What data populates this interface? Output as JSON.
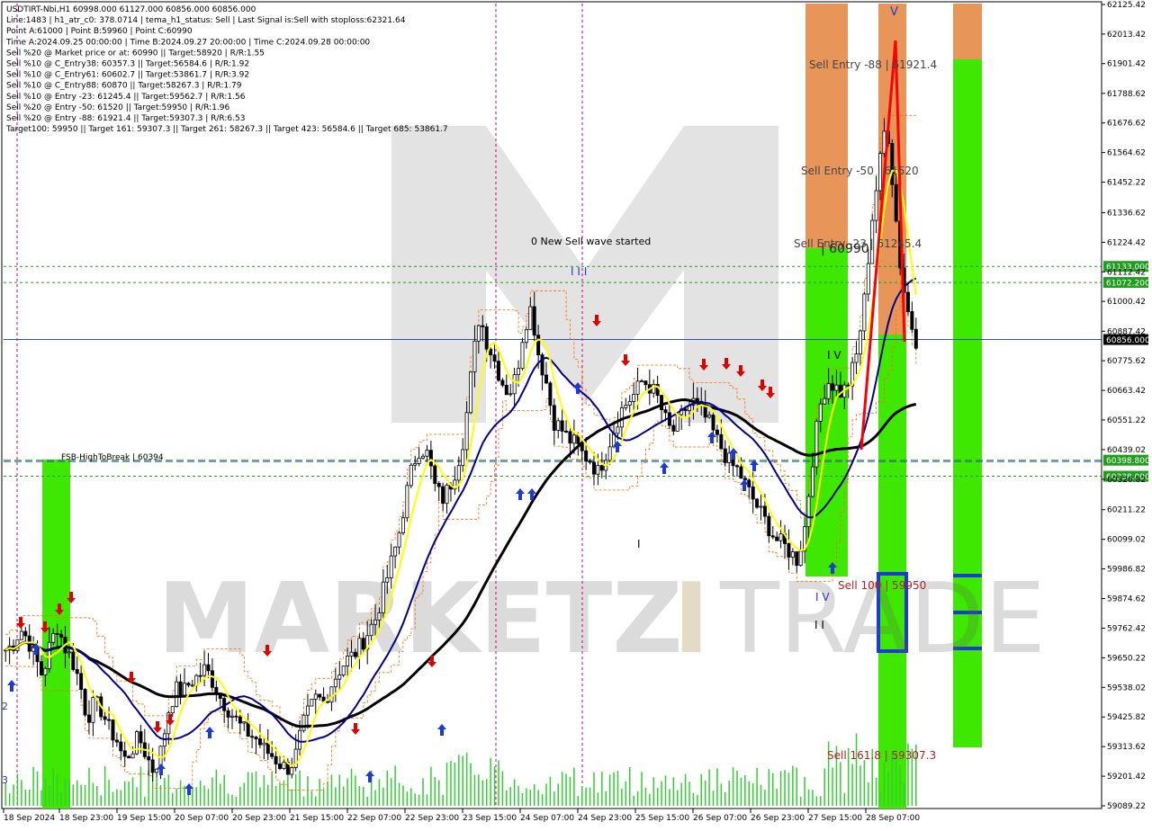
{
  "header": {
    "lines": [
      "USDTIRT-Nbi,H1  60998.000 61127.000 60856.000 60856.000",
      "Line:1483 | h1_atr_c0: 378.0714 | tema_h1_status: Sell | Last Signal is:Sell with stoploss:62321.64",
      "Point A:61000 | Point B:59960 | Point C:60990",
      "Time A:2024.09.25 00:00:00 | Time B:2024.09.27 20:00:00 | Time C:2024.09.28 00:00:00",
      "Sell %20 @ Market price or at: 60990 || Target:58920 | R/R:1.55",
      "Sell %10 @ C_Entry38: 60357.3 || Target:56584.6 | R/R:1.92",
      "Sell %10 @ C_Entry61: 60602.7 || Target:53861.7 | R/R:3.92",
      "Sell %10 @ C_Entry88: 60870 || Target:58267.3 | R/R:1.79",
      "Sell %10 @ Entry -23: 61245.4 || Target:59562.7 | R/R:1.56",
      "Sell %20 @ Entry -50: 61520 || Target:59950 | R/R:1.96",
      "Sell %20 @ Entry -88: 61921.4 || Target:59307.3 | R/R:6.53",
      "Target100: 59950 || Target 161: 59307.3 || Target 261: 58267.3 || Target 423: 56584.6 || Target 685: 53861.7"
    ]
  },
  "annotations": {
    "new_wave": "0 New Sell wave started",
    "fsb": "FSB-HighToBreak | 60394",
    "sell_entry_88": "Sell Entry -88 | 61921.4",
    "sell_entry_50": "Sell Entry -50 | 61520",
    "sell_entry_23": "Sell Entry -23 | 61245.4",
    "point_c_price": "| 60990",
    "sell_100": "Sell 100 | 59950",
    "sell_161": "Sell 161.8 | 59307.3",
    "wave_iii": "I I I",
    "wave_v_top": "V",
    "wave_iv_1": "I V",
    "wave_iv_2": "I V",
    "wave_i_low": "I",
    "wave_ii_low": "I I",
    "left_2": "2",
    "left_3": "3"
  },
  "watermark": {
    "part1": "MARKETZ",
    "part2": "I",
    "part3": "TRADE"
  },
  "colors": {
    "bull_candle": "#000000",
    "bear_candle": "#000000",
    "yellow_ma": "#ffff00",
    "blue_ma": "#00008b",
    "black_ma": "#000000",
    "green_zone": "#3ee800",
    "orange_zone": "#e8955a",
    "sell_label": "#b22222",
    "level_green": "#008800",
    "level_blue": "#2a52be",
    "arrow_up": "#1e3ad6",
    "arrow_down": "#e00000"
  },
  "chart_data": {
    "type": "candlestick",
    "symbol": "USDTIRT-Nbi",
    "timeframe": "H1",
    "ylim": [
      59089.225,
      62125.42
    ],
    "y_ticks": [
      62125.42,
      62013.42,
      61901.42,
      61788.62,
      61676.62,
      61564.62,
      61452.22,
      61336.62,
      61224.42,
      61112.42,
      61000.42,
      60887.42,
      60775.62,
      60663.42,
      60551.22,
      60439.02,
      60326.82,
      60211.22,
      60099.02,
      59986.82,
      59874.62,
      59762.42,
      59650.22,
      59538.02,
      59425.82,
      59313.62,
      59201.42,
      59089.22
    ],
    "x_labels": [
      "18 Sep 2024",
      "18 Sep 23:00",
      "19 Sep 15:00",
      "20 Sep 07:00",
      "20 Sep 23:00",
      "21 Sep 15:00",
      "22 Sep 07:00",
      "22 Sep 23:00",
      "23 Sep 15:00",
      "24 Sep 07:00",
      "24 Sep 23:00",
      "25 Sep 15:00",
      "26 Sep 07:00",
      "26 Sep 23:00",
      "27 Sep 15:00",
      "28 Sep 07:00"
    ],
    "price_levels": [
      {
        "label": "61133.000",
        "value": 61133.0,
        "color": "#1f9d1f",
        "style": "dotted"
      },
      {
        "label": "61072.200",
        "value": 61072.2,
        "color": "#1f9d1f",
        "style": "dotted"
      },
      {
        "label": "60856.000",
        "value": 60856.0,
        "color": "#000000",
        "style": "current"
      },
      {
        "label": "60398.800",
        "value": 60398.8,
        "color": "#1f9d1f",
        "style": "dashed"
      },
      {
        "label": "60338.000",
        "value": 60338.0,
        "color": "#1f9d1f",
        "style": "dotted"
      }
    ],
    "fsb_level": 60394,
    "close_path": [
      59680,
      59700,
      59760,
      59720,
      59650,
      59580,
      59700,
      59770,
      59690,
      59640,
      59560,
      59420,
      59480,
      59450,
      59380,
      59340,
      59260,
      59300,
      59350,
      59280,
      59220,
      59300,
      59450,
      59530,
      59520,
      59560,
      59580,
      59610,
      59560,
      59500,
      59460,
      59420,
      59380,
      59360,
      59340,
      59300,
      59280,
      59250,
      59230,
      59260,
      59380,
      59450,
      59500,
      59480,
      59550,
      59600,
      59640,
      59660,
      59700,
      59750,
      59800,
      59900,
      60000,
      60100,
      60250,
      60380,
      60450,
      60420,
      60300,
      60250,
      60300,
      60380,
      60500,
      60750,
      60950,
      60850,
      60780,
      60700,
      60650,
      60720,
      60900,
      60980,
      60800,
      60700,
      60550,
      60520,
      60480,
      60460,
      60420,
      60400,
      60350,
      60420,
      60500,
      60580,
      60620,
      60650,
      60700,
      60680,
      60640,
      60560,
      60500,
      60550,
      60600,
      60620,
      60580,
      60540,
      60480,
      60430,
      60380,
      60360,
      60300,
      60250,
      60200,
      60150,
      60100,
      60080,
      60050,
      60020,
      60150,
      60400,
      60600,
      60700,
      60680,
      60650,
      60700,
      60800,
      61000,
      61300,
      61500,
      61700,
      61400,
      61100,
      60950,
      60856
    ]
  }
}
